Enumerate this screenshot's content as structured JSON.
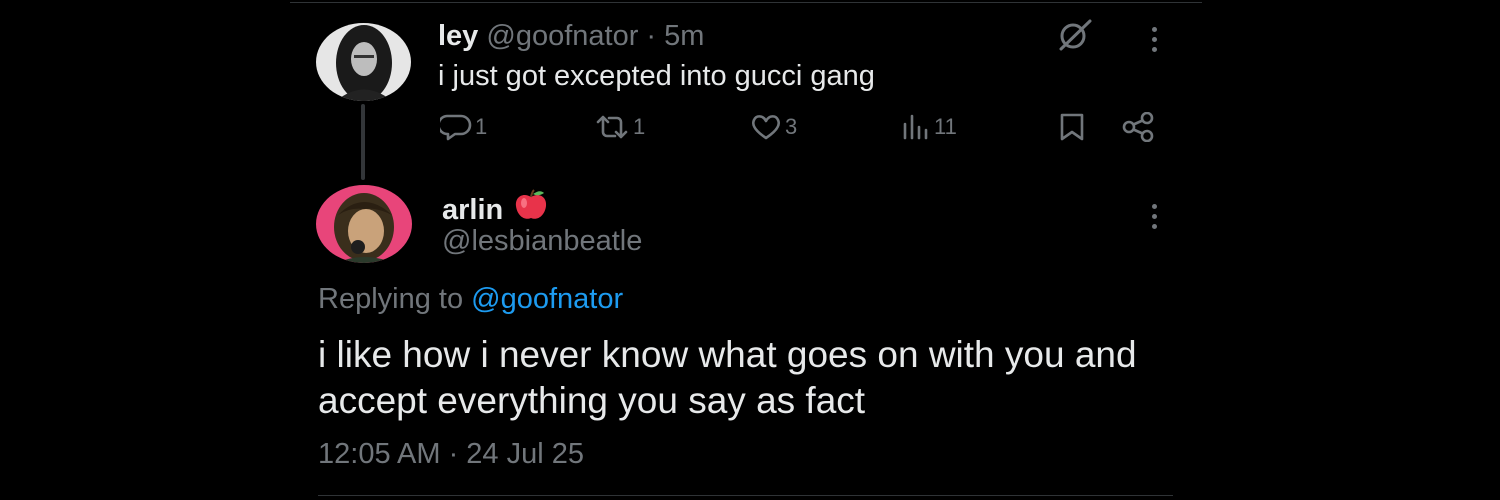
{
  "tweet1": {
    "name": "ley",
    "handle": "@goofnator",
    "separator": " · ",
    "time": "5m",
    "text": "i just got excepted into gucci gang",
    "replies": "1",
    "reposts": "1",
    "likes": "3",
    "views": "11"
  },
  "tweet2": {
    "name": "arlin",
    "handle": "@lesbianbeatle",
    "replying_prefix": "Replying to ",
    "replying_handle": "@goofnator",
    "text": "i like how i never know what goes on with you and accept everything you say as fact",
    "timestamp": "12:05 AM · 24 Jul 25"
  },
  "icons": {
    "reply": "reply-icon",
    "repost": "repost-icon",
    "like": "heart-icon",
    "views": "views-icon",
    "bookmark": "bookmark-icon",
    "share": "share-icon",
    "grok": "grok-icon",
    "more": "more-icon",
    "name_emoji": "apple-icon"
  },
  "colors": {
    "background": "#000000",
    "text": "#e7e9ea",
    "muted": "#71767b",
    "link": "#1d9bf0",
    "divider": "#2f3336"
  }
}
